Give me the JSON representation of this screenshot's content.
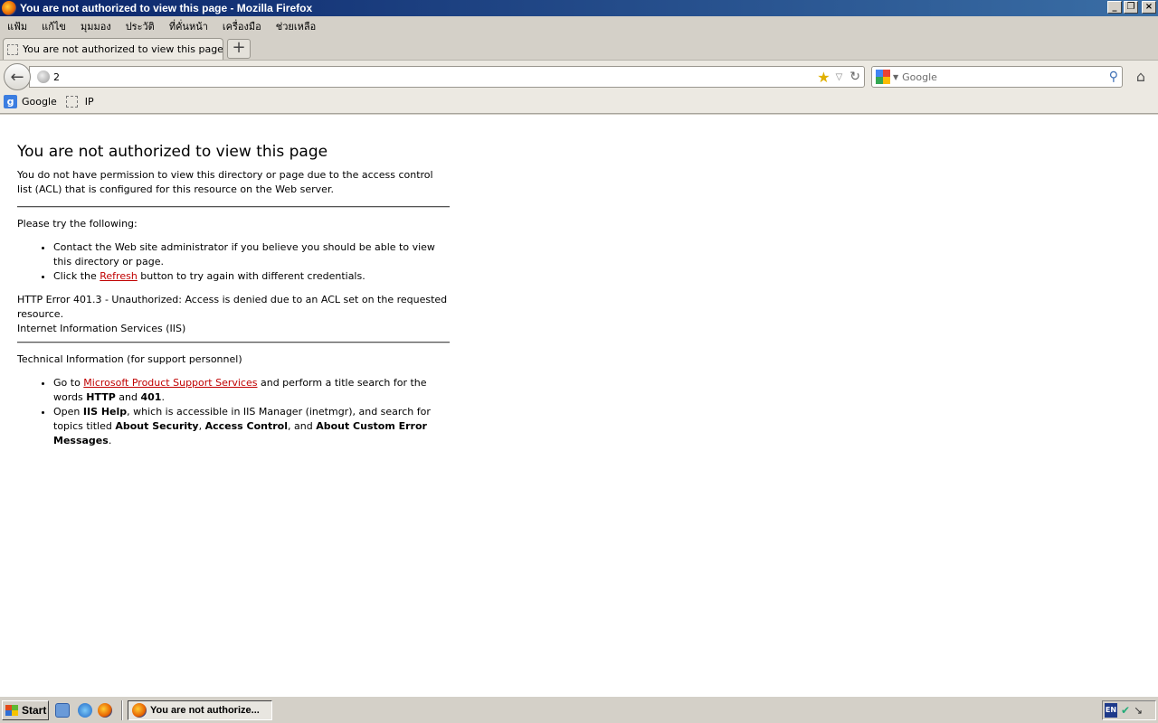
{
  "window": {
    "title": "You are not authorized to view this page - Mozilla Firefox",
    "minimize": "_",
    "maximize": "❐",
    "close": "×"
  },
  "menu": [
    "แฟ้ม",
    "แก้ไข",
    "มุมมอง",
    "ประวัติ",
    "ที่คั่นหน้า",
    "เครื่องมือ",
    "ช่วยเหลือ"
  ],
  "tab": {
    "label": "You are not authorized to view this page",
    "new_tab_label": "+"
  },
  "navbar": {
    "back": "←",
    "url": "2",
    "star": "★",
    "dropdown": "▽",
    "reload": "↻",
    "search_placeholder": "Google",
    "search_glass": "⚲",
    "home": "⌂"
  },
  "bookmarks": [
    {
      "label": "Google",
      "icon": "g"
    },
    {
      "label": "IP"
    }
  ],
  "content": {
    "heading": "You are not authorized to view this page",
    "intro": "You do not have permission to view this directory or page due to the access control list (ACL) that is configured for this resource on the Web server.",
    "try_heading": "Please try the following:",
    "try_item1": "Contact the Web site administrator if you believe you should be able to view this directory or page.",
    "try_item2_pre": "Click the ",
    "try_item2_link": "Refresh",
    "try_item2_post": " button to try again with different credentials.",
    "error_line1": "HTTP Error 401.3 - Unauthorized: Access is denied due to an ACL set on the requested resource.",
    "error_line2": "Internet Information Services (IIS)",
    "tech_heading": "Technical Information (for support personnel)",
    "tech1_pre": "Go to ",
    "tech1_link": "Microsoft Product Support Services",
    "tech1_mid": " and perform a title search for the words ",
    "tech1_b1": "HTTP",
    "tech1_and": " and ",
    "tech1_b2": "401",
    "tech1_end": ".",
    "tech2_pre": "Open ",
    "tech2_b1": "IIS Help",
    "tech2_mid": ", which is accessible in IIS Manager (inetmgr), and search for topics titled ",
    "tech2_b2": "About Security",
    "tech2_comma": ", ",
    "tech2_b3": "Access Control",
    "tech2_and": ", and ",
    "tech2_b4": "About Custom Error Messages",
    "tech2_end": "."
  },
  "taskbar": {
    "start": "Start",
    "task_label": "You are not authorize...",
    "lang": "EN",
    "tray_icon1": "✔",
    "tray_icon2": "↘"
  }
}
